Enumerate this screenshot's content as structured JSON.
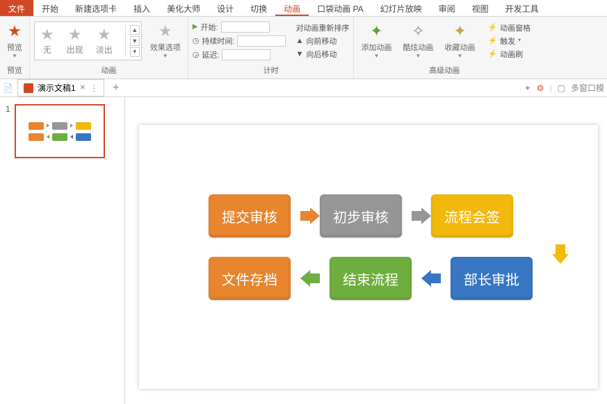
{
  "tabs": {
    "file": "文件",
    "home": "开始",
    "newtab": "新建选项卡",
    "insert": "插入",
    "beautify": "美化大师",
    "design": "设计",
    "transition": "切换",
    "animation": "动画",
    "pocket": "口袋动画 PA",
    "slideshow": "幻灯片放映",
    "review": "审阅",
    "view": "视图",
    "devtools": "开发工具"
  },
  "ribbon": {
    "preview": "预览",
    "preview2": "预览",
    "none": "无",
    "appear": "出现",
    "fade": "淡出",
    "effect_opts": "效果选项",
    "group_anim": "动画",
    "start": "开始:",
    "duration": "持续时间:",
    "delay": "延迟:",
    "group_timing": "计时",
    "reorder_title": "对动画重新排序",
    "move_fwd": "向前移动",
    "move_back": "向后移动",
    "add_anim": "添加动画",
    "cool_anim": "酷炫动画",
    "fav_anim": "收藏动画",
    "group_adv": "高级动画",
    "anim_pane": "动画窗格",
    "trigger": "触发",
    "anim_painter": "动画刷"
  },
  "docbar": {
    "title": "演示文稿1",
    "multiwin": "多窗口模"
  },
  "thumb": {
    "num": "1"
  },
  "flow": {
    "b1": "提交审核",
    "b2": "初步审核",
    "b3": "流程会签",
    "b4": "部长审批",
    "b5": "结束流程",
    "b6": "文件存档"
  }
}
